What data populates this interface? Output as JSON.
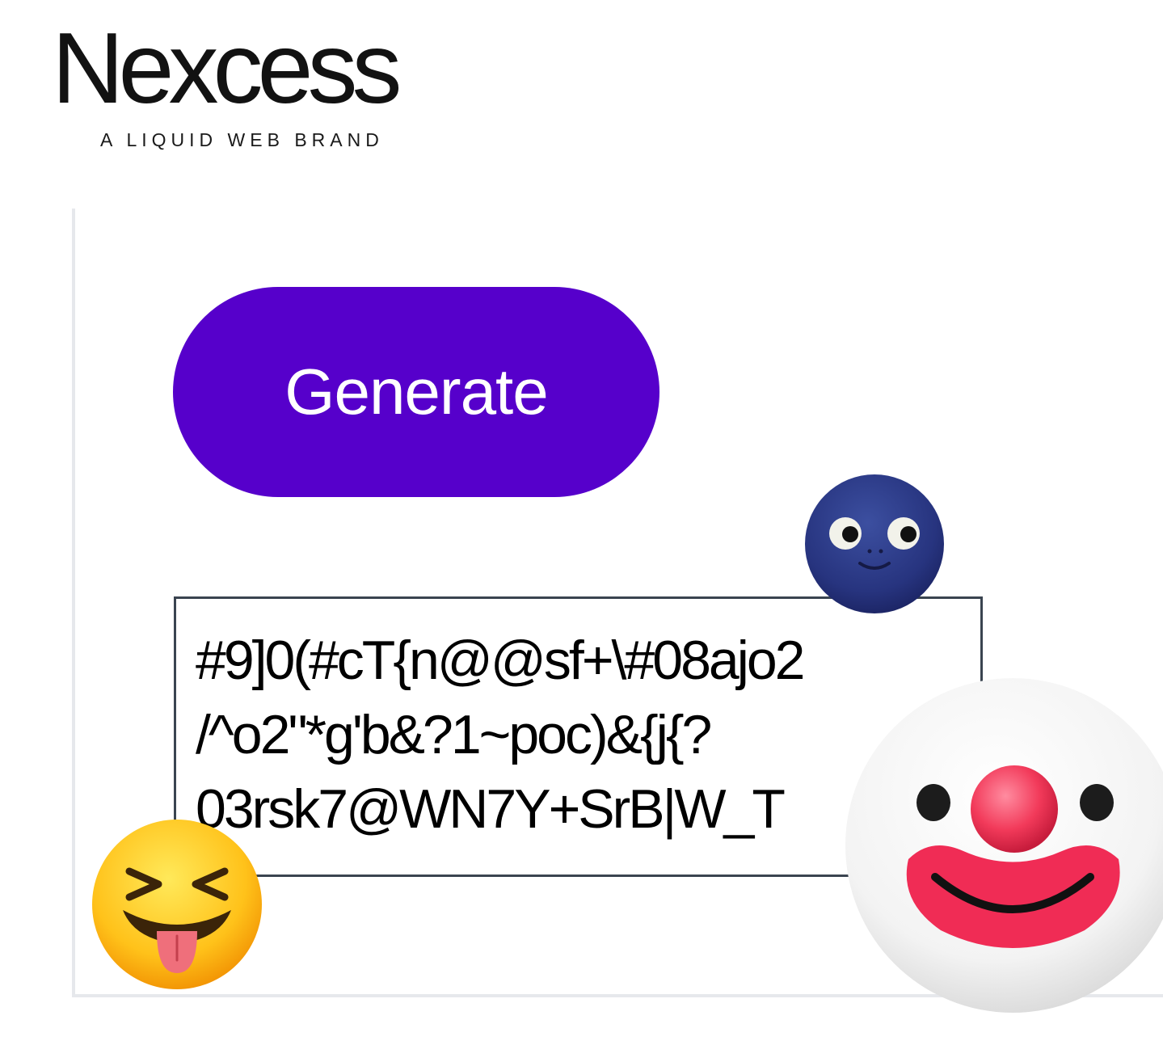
{
  "logo": {
    "wordmark": "Nexcess",
    "tagline": "A LIQUID WEB BRAND"
  },
  "generator": {
    "button_label": "Generate",
    "password": "#9]0(#cT{n@@sf+\\#08ajo2\n/^o2\"*g'b&?1~poc)&{j{?\n03rsk7@WN7Y+SrB|W_T"
  },
  "stickers": [
    {
      "icon": "new-moon-face-emoji"
    },
    {
      "icon": "squinting-face-with-tongue-emoji"
    },
    {
      "icon": "clown-face-emoji"
    }
  ],
  "colors": {
    "button": "#5600cb",
    "border": "#3a4450",
    "panel_border": "#e6e8ec"
  }
}
